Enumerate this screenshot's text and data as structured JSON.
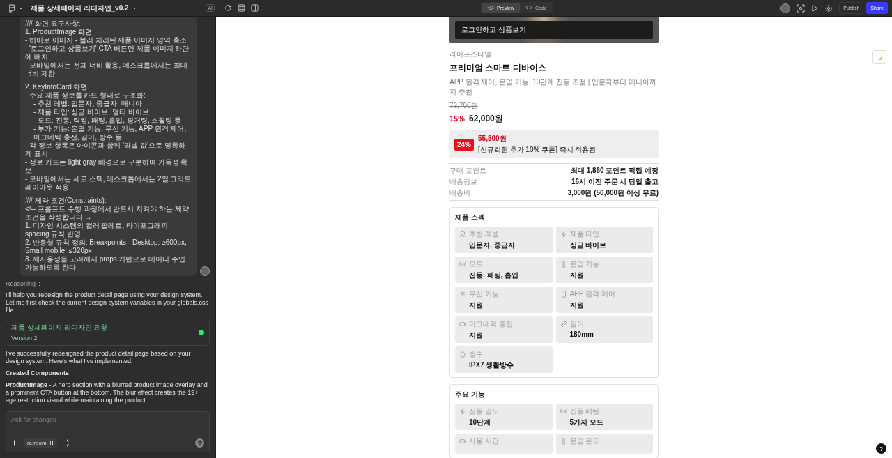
{
  "topbar": {
    "title": "제품 상세페이지 리디자인_v0.2",
    "ai_badge": "AI",
    "view_tabs": [
      {
        "label": "Preview",
        "selected": true
      },
      {
        "label": "Code",
        "selected": false
      }
    ],
    "publish": "Publish",
    "share": "Share"
  },
  "chat": {
    "prompt_blocks": [
      [
        {
          "text": "## 화면 요구사항:",
          "indent": false
        },
        {
          "text": "1. ProductImage 화면",
          "indent": false
        },
        {
          "text": "- 히어로 이미지 - 블러 처리된 제품 이미지 영역 축소",
          "indent": false
        },
        {
          "text": "- '로그인하고 상품보기' CTA 버튼만 제품 이미지 하단에 배치",
          "indent": false
        },
        {
          "text": "- 모바일에서는 전체 너비 활용, 데스크톱에서는 최대 너비 제한",
          "indent": false
        }
      ],
      [
        {
          "text": "2. KeyInfoCard 화면",
          "indent": false
        },
        {
          "text": "- 주요 제품 정보를 카드 형태로 구조화:",
          "indent": false
        },
        {
          "text": "- 추천 레벨: 입문자, 중급자, 매니아",
          "indent": true
        },
        {
          "text": "- 제품 타입: 싱글 바이브, 멀티 바이브",
          "indent": true
        },
        {
          "text": "- 모드: 진동, 릭킹, 패팅, 흡입, 핑거링, 스윌링 등",
          "indent": true
        },
        {
          "text": "- 부가 기능: 온열 기능, 무선 기능, APP 원격 제어, 마그네틱 충전, 길이, 방수 등",
          "indent": true
        },
        {
          "text": "- 각 정보 항목은 아이콘과 함께 '라벨-값'으로 명확하게 표시",
          "indent": false
        },
        {
          "text": "- 정보 카드는 light gray 배경으로 구분하여 가독성 확보",
          "indent": false
        },
        {
          "text": "- 모바일에서는 세로 스택, 데스크톱에서는 2열 그리드 레이아웃 적용",
          "indent": false
        }
      ],
      [
        {
          "text": "## 제약 조건(Constraints):",
          "indent": false
        },
        {
          "text": "<!-- 프롬프트 수행 과정에서 반드시 지켜야 하는 제약 조건을 작성합니다 →",
          "indent": false
        },
        {
          "text": "1. 디자인 시스템의 컬러 팔레트, 타이포그래피, spacing 규칙 반영",
          "indent": false
        },
        {
          "text": "2. 반응형 규칙 정의: Breakpoints - Desktop: ≥600px, Small mobile: ≤320px",
          "indent": false
        },
        {
          "text": "3. 재사용성을 고려해서 props 기반으로 데이터 주입 가능하도록 한다",
          "indent": false
        }
      ]
    ],
    "reasoning": "Reasoning",
    "intro": "I'll help you redesign the product detail page using your design system. Let me first check the current design system variables in your globals.css file.",
    "version_card": {
      "title": "제품 상세페이지 리디자인 요청",
      "version": "Version 2"
    },
    "summary": "I've successfully redesigned the product detail page based on your design system. Here's what I've implemented:",
    "heading": "Created Components",
    "component_note": "**ProductImage** - A hero section with a blurred product image overlay and a prominent CTA button at the bottom. The blur effect creates the 19+ age restriction visual while maintaining the product",
    "input": {
      "placeholder": "Ask for changes",
      "chip": "re:room"
    }
  },
  "preview": {
    "cta": "로그인하고 상품보기",
    "category": "라이프스타일",
    "title": "프리미엄 스마트 디바이스",
    "subtitle": "APP 원격 제어, 온열 기능, 10단계 진동 조절 | 입문자부터 매니아까지 추천",
    "original_price": "72,700원",
    "discount": "15%",
    "price": "62,000원",
    "coupon": {
      "badge": "24%",
      "price": "55,800원",
      "note": "[신규회원 추가 10% 쿠폰] 즉시 적용됨"
    },
    "info_rows": [
      {
        "label": "구매 포인트",
        "value": "최대 1,860 포인트 적립 예정"
      },
      {
        "label": "배송정보",
        "value": "16시 이전 주문 시 당일 출고"
      },
      {
        "label": "배송비",
        "value": "3,000원 (50,000원 이상 무료)"
      }
    ],
    "sections": [
      {
        "title": "제품 스펙",
        "items": [
          {
            "label": "추천 레벨",
            "value": "입문자, 중급자"
          },
          {
            "label": "제품 타입",
            "value": "싱글 바이브"
          },
          {
            "label": "모드",
            "value": "진동, 패팅, 흡입"
          },
          {
            "label": "온열 기능",
            "value": "지원"
          },
          {
            "label": "무선 기능",
            "value": "지원"
          },
          {
            "label": "APP 원격 제어",
            "value": "지원"
          },
          {
            "label": "마그네틱 충전",
            "value": "지원"
          },
          {
            "label": "길이",
            "value": "180mm"
          },
          {
            "label": "방수",
            "value": "IPX7 생활방수"
          }
        ]
      },
      {
        "title": "주요 기능",
        "items": [
          {
            "label": "진동 강도",
            "value": "10단계"
          },
          {
            "label": "진동 패턴",
            "value": "5가지 모드"
          },
          {
            "label": "사용 시간"
          },
          {
            "label": "온열 온도"
          }
        ]
      }
    ]
  },
  "help": "?"
}
